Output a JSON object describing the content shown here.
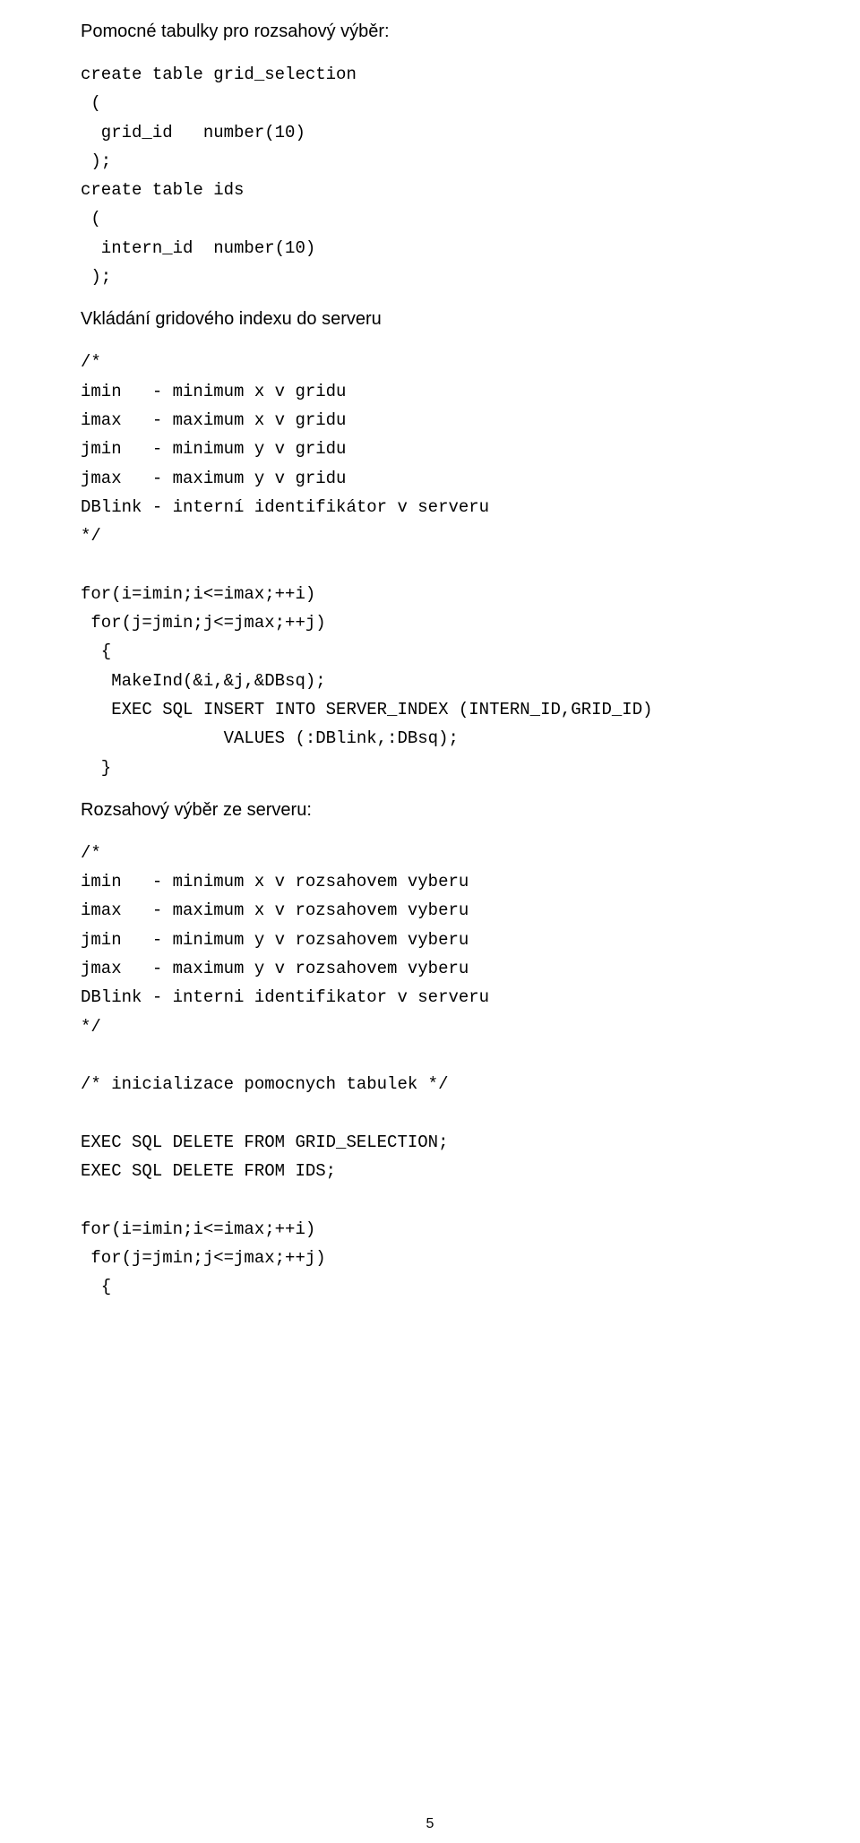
{
  "h1": "Pomocné tabulky pro rozsahový výběr:",
  "code1": "create table grid_selection\n (\n  grid_id   number(10)\n );\ncreate table ids\n (\n  intern_id  number(10)\n );",
  "h2": "Vkládání gridového indexu do serveru",
  "code2": "/*\nimin   - minimum x v gridu\nimax   - maximum x v gridu\njmin   - minimum y v gridu\njmax   - maximum y v gridu\nDBlink - interní identifikátor v serveru\n*/\n\nfor(i=imin;i<=imax;++i)\n for(j=jmin;j<=jmax;++j)\n  {\n   MakeInd(&i,&j,&DBsq);\n   EXEC SQL INSERT INTO SERVER_INDEX (INTERN_ID,GRID_ID)\n              VALUES (:DBlink,:DBsq);\n  }",
  "h3": "Rozsahový výběr ze serveru:",
  "code3": "/*\nimin   - minimum x v rozsahovem vyberu\nimax   - maximum x v rozsahovem vyberu\njmin   - minimum y v rozsahovem vyberu\njmax   - maximum y v rozsahovem vyberu\nDBlink - interni identifikator v serveru\n*/\n\n/* inicializace pomocnych tabulek */\n\nEXEC SQL DELETE FROM GRID_SELECTION;\nEXEC SQL DELETE FROM IDS;\n\nfor(i=imin;i<=imax;++i)\n for(j=jmin;j<=jmax;++j)\n  {",
  "page_number": "5"
}
